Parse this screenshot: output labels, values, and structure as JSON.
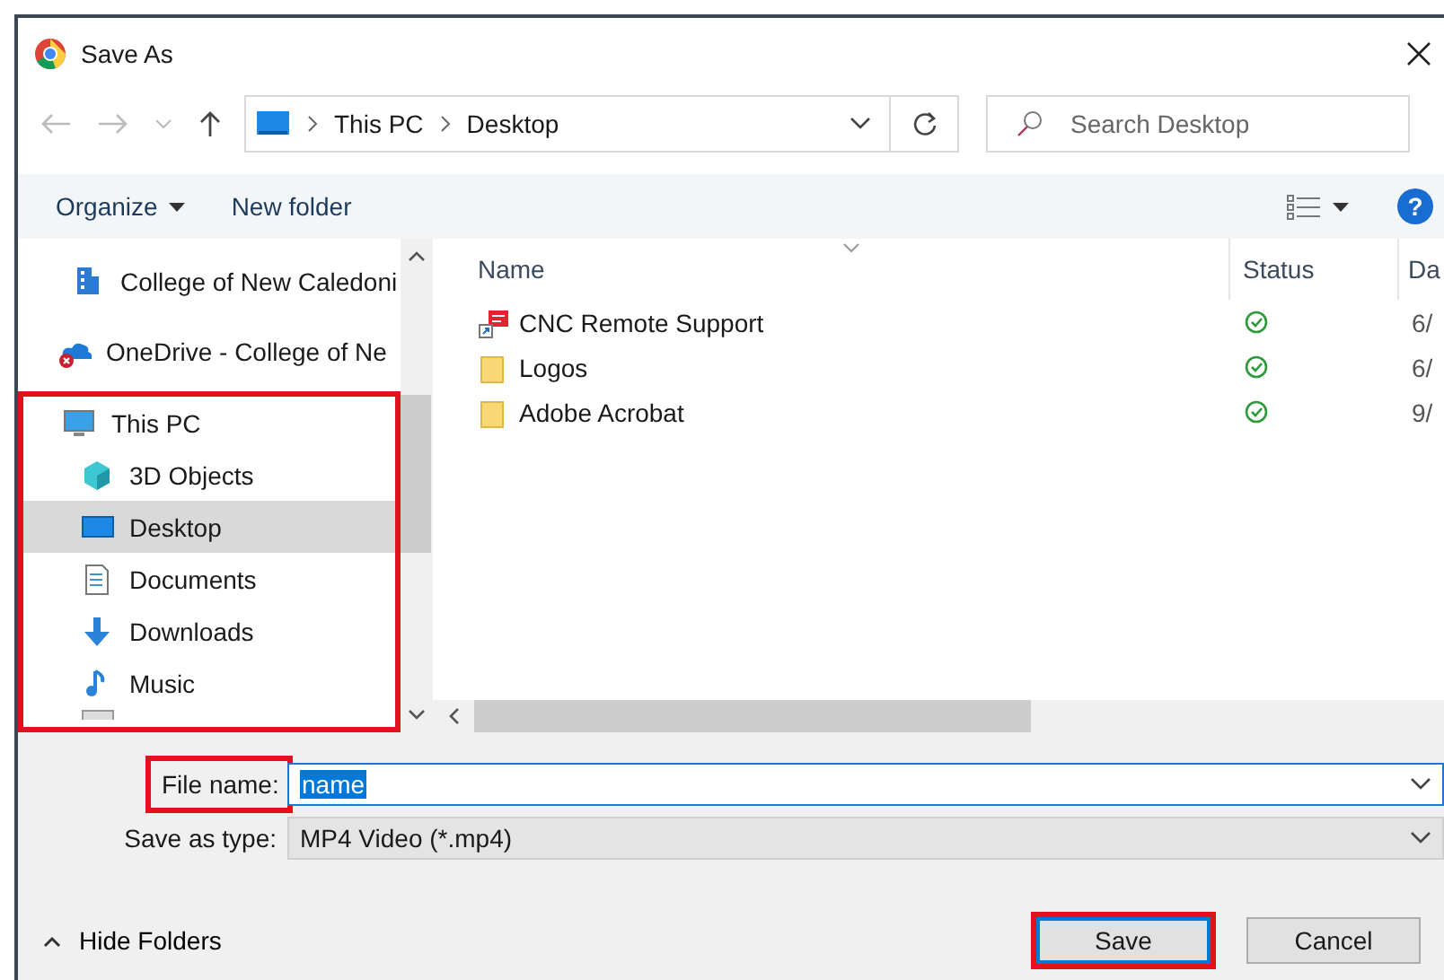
{
  "window": {
    "title": "Save As"
  },
  "address": {
    "path": [
      "This PC",
      "Desktop"
    ]
  },
  "search": {
    "placeholder": "Search Desktop"
  },
  "toolbar": {
    "organize": "Organize",
    "new_folder": "New folder",
    "help": "?"
  },
  "sidebar": {
    "items": [
      {
        "label": "College of New Caledoni",
        "kind": "org",
        "selected": false
      },
      {
        "label": "OneDrive - College of Ne",
        "kind": "cloud",
        "selected": false
      }
    ],
    "this_pc": {
      "label": "This PC",
      "highlighted": true,
      "children": [
        {
          "label": "3D Objects",
          "kind": "cube",
          "selected": false
        },
        {
          "label": "Desktop",
          "kind": "desktop",
          "selected": true
        },
        {
          "label": "Documents",
          "kind": "document",
          "selected": false
        },
        {
          "label": "Downloads",
          "kind": "download",
          "selected": false
        },
        {
          "label": "Music",
          "kind": "music",
          "selected": false
        }
      ]
    }
  },
  "table": {
    "columns": [
      "Name",
      "Status",
      "Da"
    ],
    "rows": [
      {
        "name": "CNC Remote Support",
        "kind": "shortcut",
        "date": "6/"
      },
      {
        "name": "Logos",
        "kind": "folder",
        "date": "6/"
      },
      {
        "name": "Adobe Acrobat",
        "kind": "folder",
        "date": "9/"
      }
    ]
  },
  "file_name": {
    "label": "File name:",
    "value": "name",
    "highlighted": true
  },
  "save_type": {
    "label": "Save as type:",
    "value": "MP4 Video (*.mp4)"
  },
  "hide_folders": "Hide Folders",
  "buttons": [
    {
      "label": "Save",
      "highlighted": true
    },
    {
      "label": "Cancel",
      "highlighted": false
    }
  ]
}
